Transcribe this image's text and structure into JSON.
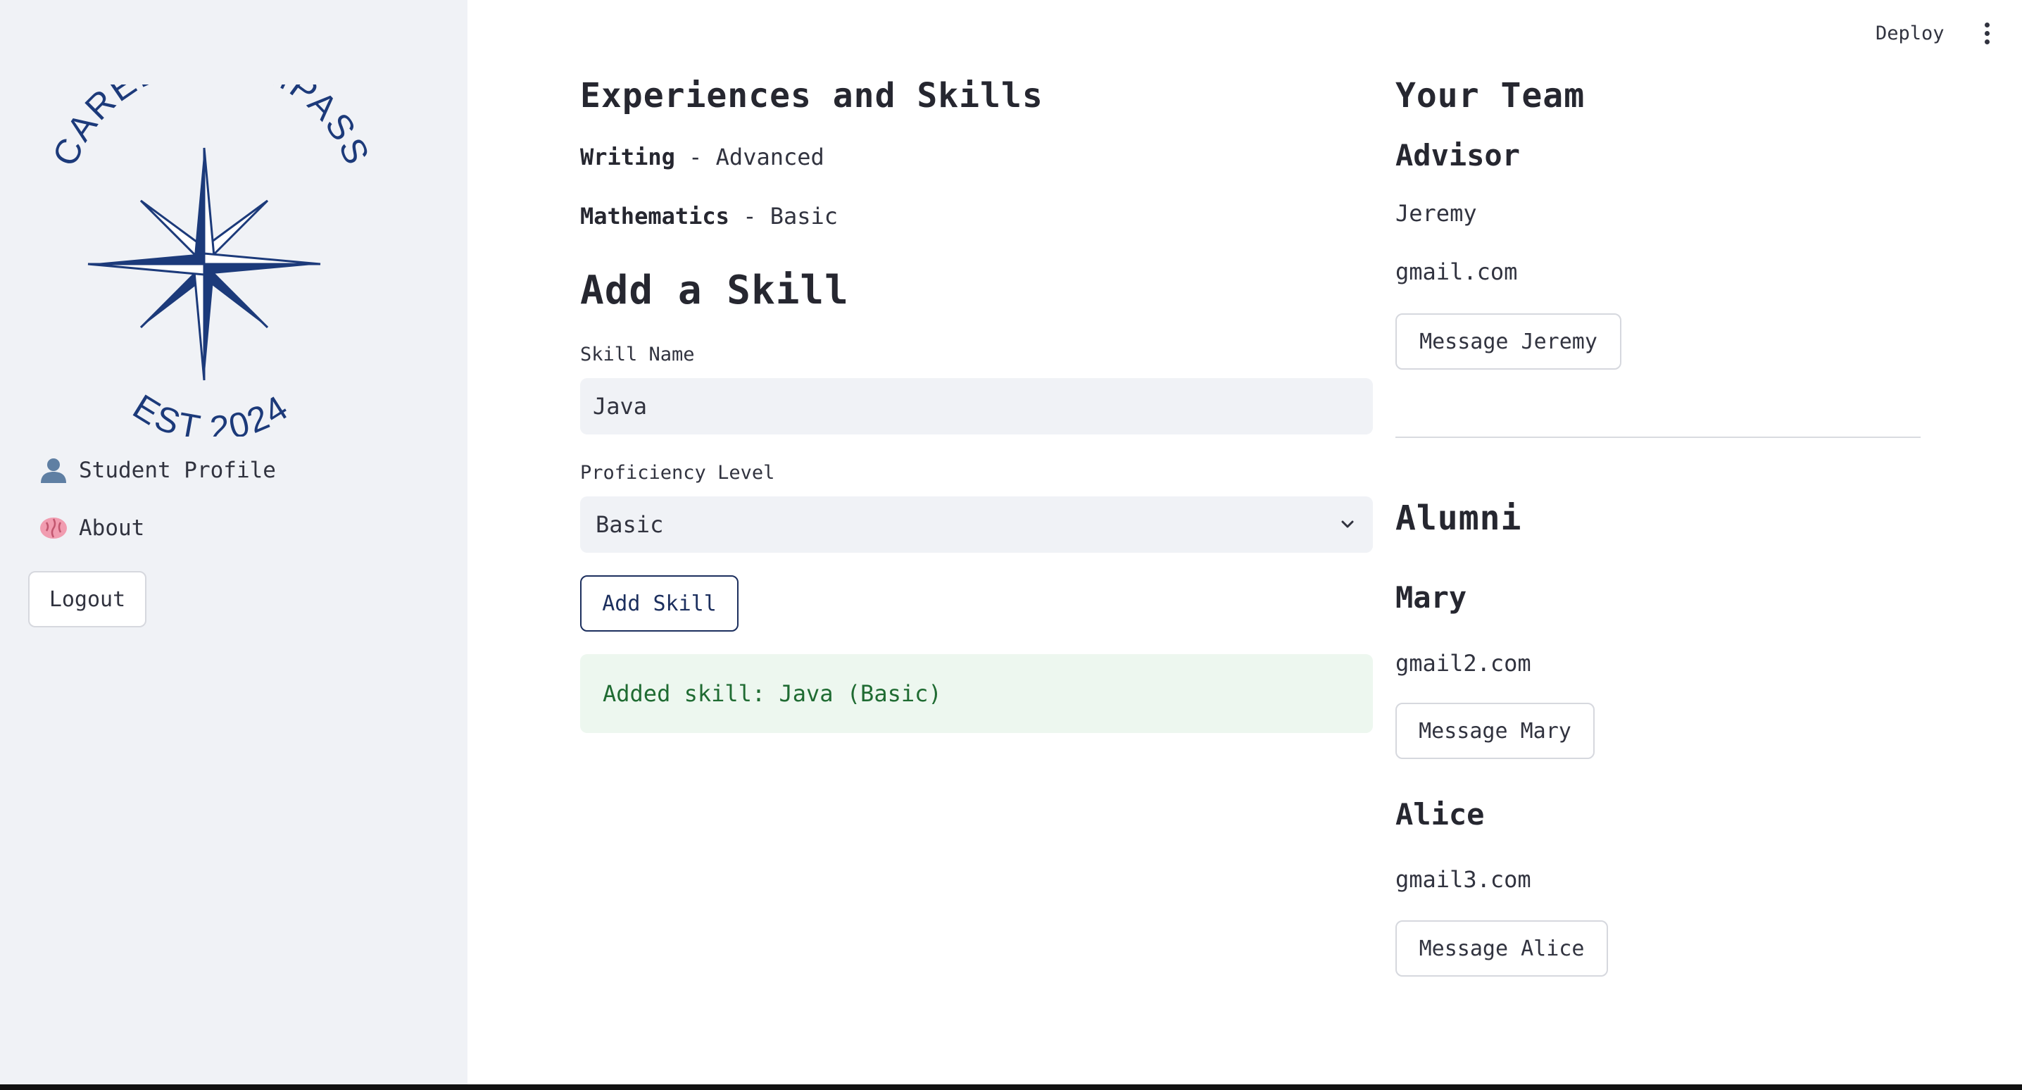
{
  "header": {
    "deploy_label": "Deploy",
    "menu_icon": "kebab-menu-icon"
  },
  "sidebar": {
    "logo": {
      "top_text": "CAREER COMPASS",
      "bottom_text": "EST 2024",
      "icon": "compass-star-icon",
      "color": "#1c3a7a"
    },
    "nav": [
      {
        "label": "Student Profile",
        "icon": "person-silhouette-icon"
      },
      {
        "label": "About",
        "icon": "brain-icon"
      }
    ],
    "logout_label": "Logout"
  },
  "main": {
    "experiences": {
      "title": "Experiences and Skills",
      "skills": [
        {
          "name": "Writing",
          "separator": " - ",
          "level": "Advanced"
        },
        {
          "name": "Mathematics",
          "separator": " - ",
          "level": "Basic"
        }
      ]
    },
    "add_skill": {
      "title": "Add a Skill",
      "skill_name_label": "Skill Name",
      "skill_name_value": "Java",
      "proficiency_label": "Proficiency Level",
      "proficiency_value": "Basic",
      "button_label": "Add Skill",
      "success_message": "Added skill: Java (Basic)"
    }
  },
  "team": {
    "title": "Your Team",
    "advisor": {
      "heading": "Advisor",
      "name": "Jeremy",
      "email": "gmail.com",
      "button_label": "Message Jeremy"
    },
    "alumni": {
      "heading": "Alumni",
      "members": [
        {
          "name": "Mary",
          "email": "gmail2.com",
          "button_label": "Message Mary"
        },
        {
          "name": "Alice",
          "email": "gmail3.com",
          "button_label": "Message Alice"
        }
      ]
    }
  },
  "colors": {
    "accent": "#1c2f5e",
    "sidebar_bg": "#f0f2f6",
    "success_bg": "#edf7ef",
    "success_text": "#1f6b32"
  }
}
